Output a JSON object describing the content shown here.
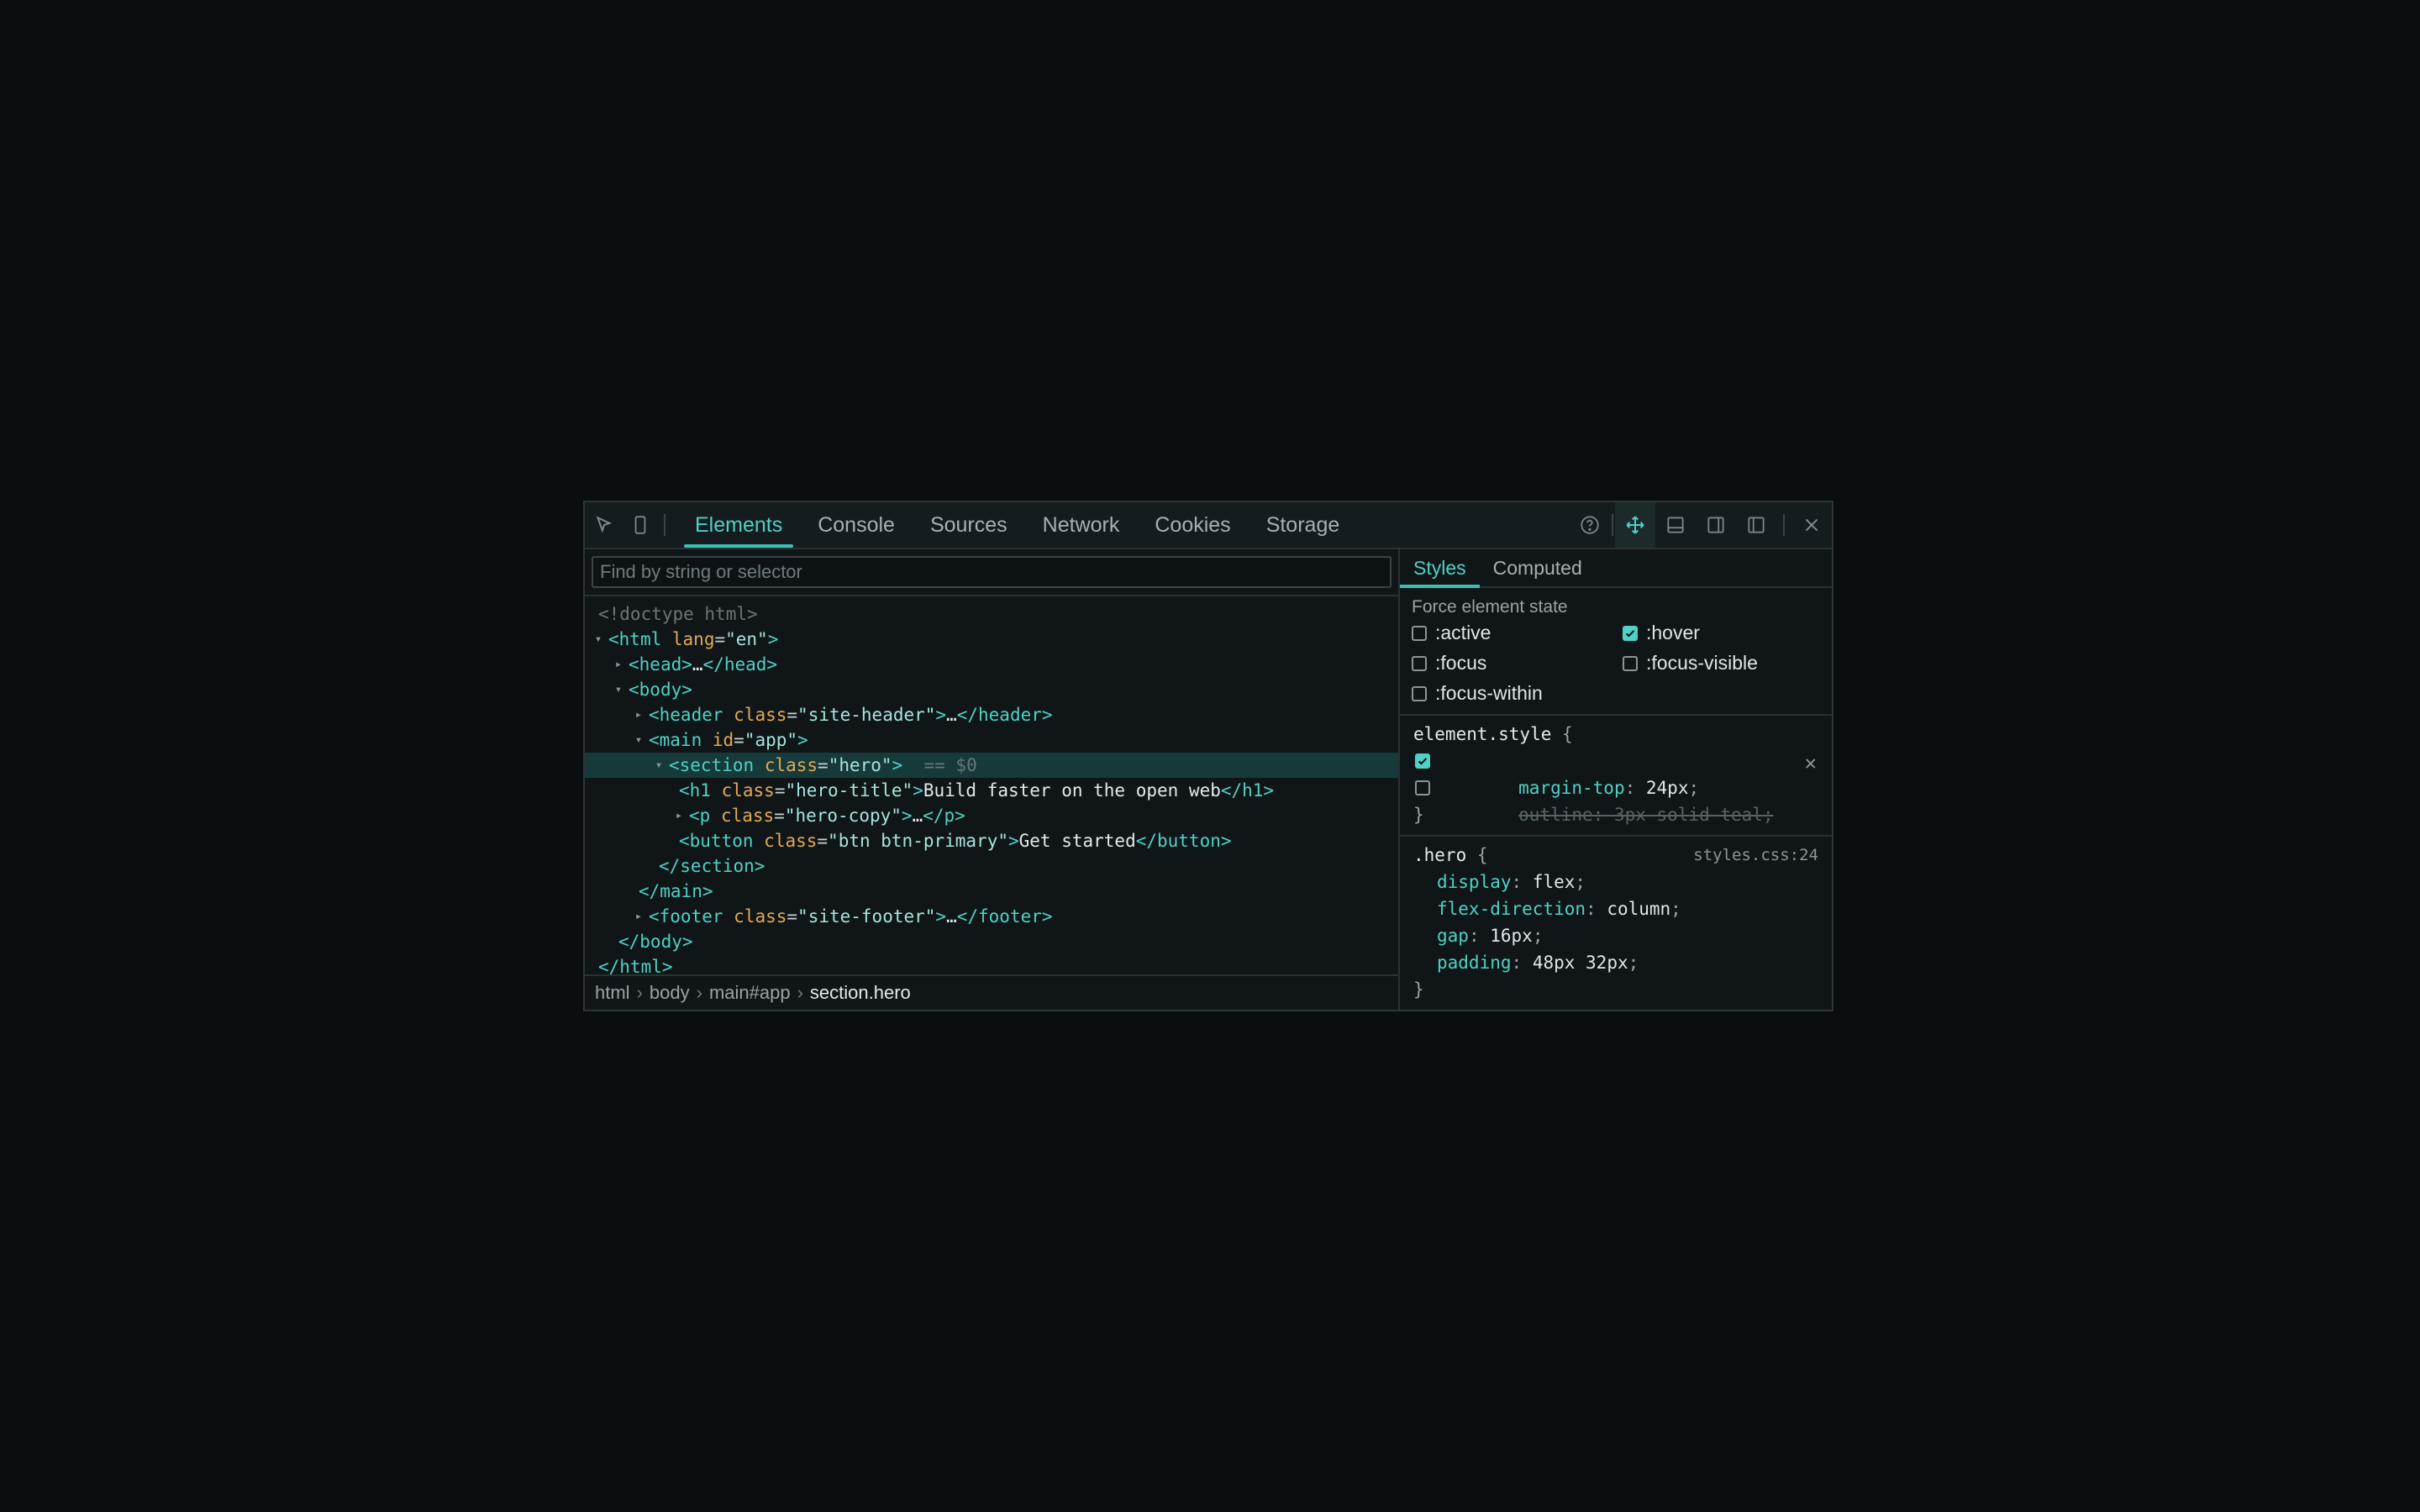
{
  "toolbar": {
    "tabs": [
      "Elements",
      "Console",
      "Sources",
      "Network",
      "Cookies",
      "Storage"
    ],
    "active_tab": "Elements"
  },
  "filter": {
    "placeholder": "Find by string or selector",
    "value": ""
  },
  "tree": {
    "doctype": "<!doctype html>",
    "html_tag": "html",
    "lang_attr": "lang",
    "lang_val": "\"en\"",
    "head": "head",
    "body": "body",
    "header_class": "\"site-header\"",
    "main_id": "\"app\"",
    "section_class": "\"hero\"",
    "dollar": "== $0",
    "h1_class": "\"hero-title\"",
    "h1_text": "Build faster on the open web",
    "p_class": "\"hero-copy\"",
    "button_class": "\"btn btn-primary\"",
    "button_text": "Get started",
    "footer_class": "\"site-footer\"",
    "ellipsis": "…"
  },
  "breadcrumb": [
    "html",
    "body",
    "main#app",
    "section.hero"
  ],
  "styles_tabs": [
    "Styles",
    "Computed"
  ],
  "force_state": {
    "title": "Force element state",
    "items": [
      {
        "label": ":active",
        "checked": false
      },
      {
        "label": ":hover",
        "checked": true
      },
      {
        "label": ":focus",
        "checked": false
      },
      {
        "label": ":focus-visible",
        "checked": false
      },
      {
        "label": ":focus-within",
        "checked": false
      }
    ]
  },
  "element_style": {
    "selector": "element.style",
    "decls": [
      {
        "prop": "margin-top",
        "value": "24px",
        "enabled": true
      },
      {
        "text": "outline: 3px solid teal;",
        "enabled": false
      }
    ]
  },
  "hero_rule": {
    "selector": ".hero",
    "source": "styles.css:24",
    "decls": [
      {
        "prop": "display",
        "value": "flex"
      },
      {
        "prop": "flex-direction",
        "value": "column"
      },
      {
        "prop": "gap",
        "value": "16px"
      },
      {
        "prop": "padding",
        "value": "48px 32px"
      }
    ]
  },
  "colors": {
    "accent": "#4fd1c5",
    "background": "#0a0e10",
    "panel": "#101618",
    "selected_row": "#163a3a"
  }
}
